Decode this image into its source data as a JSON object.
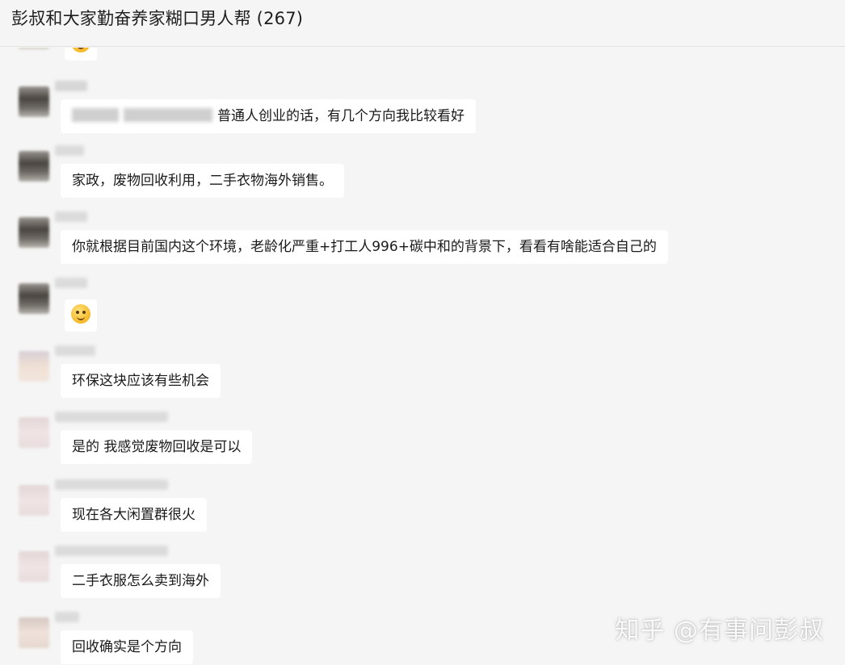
{
  "header": {
    "title": "彭叔和大家勤奋养家糊口男人帮 (267)"
  },
  "messages": [
    {
      "text": "",
      "emoji": "thinking-face-emoji"
    },
    {
      "text": "普通人创业的话，有几个方向我比较看好"
    },
    {
      "text": "家政，废物回收利用，二手衣物海外销售。"
    },
    {
      "text": "你就根据目前国内这个环境，老龄化严重+打工人996+碳中和的背景下，看看有啥能适合自己的"
    },
    {
      "text": "",
      "emoji": "thinking-face-emoji"
    },
    {
      "text": "环保这块应该有些机会"
    },
    {
      "text": "是的 我感觉废物回收是可以"
    },
    {
      "text": "现在各大闲置群很火"
    },
    {
      "text": "二手衣服怎么卖到海外"
    },
    {
      "text": "回收确实是个方向"
    }
  ],
  "watermark": {
    "text": "知乎 @有事问彭叔"
  },
  "colors": {
    "background": "#f5f5f5",
    "bubble": "#ffffff",
    "text": "#1a1a1a"
  }
}
